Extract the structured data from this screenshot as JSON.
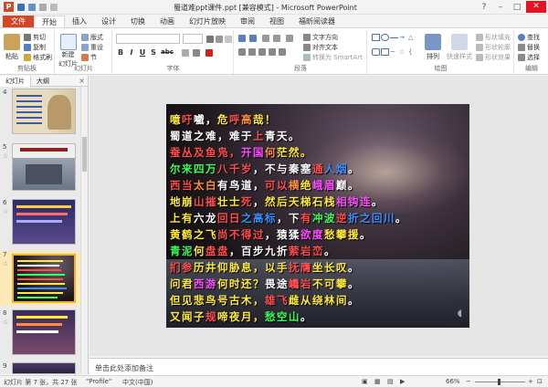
{
  "window": {
    "title": "蜀道难ppt课件.ppt [兼容模式] - Microsoft PowerPoint",
    "app_logo": "P"
  },
  "tabs": [
    "文件",
    "开始",
    "插入",
    "设计",
    "切换",
    "动画",
    "幻灯片放映",
    "审阅",
    "视图",
    "福昕阅读器"
  ],
  "ribbon": {
    "clipboard": {
      "paste": "粘贴",
      "cut": "剪切",
      "copy": "复制",
      "format_painter": "格式刷",
      "label": "剪贴板"
    },
    "slides": {
      "new_slide": "新建",
      "new_slide2": "幻灯片",
      "layout": "版式",
      "reset": "重设",
      "section": "节",
      "label": "幻灯片"
    },
    "font": {
      "label": "字体",
      "bold": "B",
      "italic": "I",
      "underline": "U",
      "shadow": "S",
      "strike": "abc"
    },
    "paragraph": {
      "text_direction": "文字方向",
      "align_text": "对齐文本",
      "smartart": "转换为 SmartArt",
      "label": "段落"
    },
    "drawing": {
      "arrange": "排列",
      "quick_styles": "快速样式",
      "shape_fill": "形状填充",
      "shape_outline": "形状轮廓",
      "shape_effects": "形状效果",
      "label": "绘图"
    },
    "editing": {
      "find": "查找",
      "replace": "替换",
      "select": "选择",
      "label": "编辑"
    }
  },
  "panel": {
    "tabs": [
      "幻灯片",
      "大纲"
    ],
    "close": "×",
    "thumbs": [
      {
        "num": "4",
        "selected": false
      },
      {
        "num": "5",
        "selected": false
      },
      {
        "num": "6",
        "selected": false
      },
      {
        "num": "7",
        "selected": true
      },
      {
        "num": "8",
        "selected": false
      },
      {
        "num": "9",
        "selected": false
      }
    ]
  },
  "slide": {
    "lines": [
      {
        "segments": [
          [
            "噫",
            "#ffea3a"
          ],
          [
            "吁",
            "#ff4d4d"
          ],
          [
            "嚱",
            "#ffffff"
          ],
          [
            "，",
            "#ffffff"
          ],
          [
            "危",
            "#ffea3a"
          ],
          [
            "呼",
            "#ff4d4d"
          ],
          [
            "高",
            "#ff8f3a"
          ],
          [
            "哉",
            "#ffea3a"
          ],
          [
            "！",
            "#ffea3a"
          ]
        ]
      },
      {
        "segments": [
          [
            "蜀道之难，",
            "#ffffff"
          ],
          [
            "难于",
            "#ffffff"
          ],
          [
            "上",
            "#ff4d4d"
          ],
          [
            "青天",
            "#ffffff"
          ],
          [
            "。",
            "#ffffff"
          ]
        ]
      },
      {
        "segments": [
          [
            "蚕丛及鱼凫，",
            "#ff4d4d"
          ],
          [
            "开国",
            "#ff4dff"
          ],
          [
            "何",
            "#ff8f3a"
          ],
          [
            "茫然。",
            "#ffea3a"
          ]
        ]
      },
      {
        "segments": [
          [
            "尔来四万",
            "#3aff5a"
          ],
          [
            "八千岁",
            "#ff4d4d"
          ],
          [
            "，",
            "#ffffff"
          ],
          [
            "不与秦塞",
            "#ffffff"
          ],
          [
            "通",
            "#ff4d4d"
          ],
          [
            "人烟",
            "#3a8fff"
          ],
          [
            "。",
            "#ffffff"
          ]
        ]
      },
      {
        "segments": [
          [
            "西当",
            "#ff4d4d"
          ],
          [
            "太白",
            "#ff8f3a"
          ],
          [
            "有鸟道，",
            "#ffffff"
          ],
          [
            "可以",
            "#ff4d4d"
          ],
          [
            "横",
            "#ff8f3a"
          ],
          [
            "绝",
            "#ffea3a"
          ],
          [
            "峨眉",
            "#ff4dff"
          ],
          [
            "巅",
            "#ffffff"
          ],
          [
            "。",
            "#ffffff"
          ]
        ]
      },
      {
        "segments": [
          [
            "地崩",
            "#ffea3a"
          ],
          [
            "山摧",
            "#ff4d4d"
          ],
          [
            "壮士",
            "#ffea3a"
          ],
          [
            "死",
            "#ff4d4d"
          ],
          [
            "，",
            "#ffffff"
          ],
          [
            "然后天梯石栈",
            "#ffea3a"
          ],
          [
            "相钩连",
            "#ff4dff"
          ],
          [
            "。",
            "#ffffff"
          ]
        ]
      },
      {
        "segments": [
          [
            "上有",
            "#ffea3a"
          ],
          [
            "六龙",
            "#ffffff"
          ],
          [
            "回日",
            "#ff4d4d"
          ],
          [
            "之高标",
            "#3a8fff"
          ],
          [
            "，下",
            "#ffffff"
          ],
          [
            "有",
            "#ff4d4d"
          ],
          [
            "冲波",
            "#3aff5a"
          ],
          [
            "逆",
            "#ff4d4d"
          ],
          [
            "折之回川",
            "#3a8fff"
          ],
          [
            "。",
            "#ffffff"
          ]
        ]
      },
      {
        "segments": [
          [
            "黄鹤之飞",
            "#ffea3a"
          ],
          [
            "尚不得过",
            "#ff4d4d"
          ],
          [
            "，",
            "#ffffff"
          ],
          [
            "猿猱",
            "#ffffff"
          ],
          [
            "欲度",
            "#ff4dff"
          ],
          [
            "愁攀援",
            "#ffea3a"
          ],
          [
            "。",
            "#ffffff"
          ]
        ]
      },
      {
        "segments": [
          [
            "青泥",
            "#3aff5a"
          ],
          [
            "何",
            "#ffea3a"
          ],
          [
            "盘盘",
            "#ff4d4d"
          ],
          [
            "，",
            "#ffffff"
          ],
          [
            "百步九折",
            "#ffffff"
          ],
          [
            "萦岩峦",
            "#ff4d4d"
          ],
          [
            "。",
            "#ffffff"
          ]
        ]
      },
      {
        "segments": [
          [
            "扪参",
            "#ff4d4d"
          ],
          [
            "历井仰胁息，",
            "#ffea3a"
          ],
          [
            "以手",
            "#ffea3a"
          ],
          [
            "抚膺",
            "#ff4d4d"
          ],
          [
            "坐长叹",
            "#ffea3a"
          ],
          [
            "。",
            "#ffffff"
          ]
        ]
      },
      {
        "segments": [
          [
            "问君",
            "#ffea3a"
          ],
          [
            "西游",
            "#ff4dff"
          ],
          [
            "何时还？",
            "#ffea3a"
          ],
          [
            "畏途",
            "#ffffff"
          ],
          [
            "巉岩",
            "#ff4d4d"
          ],
          [
            "不可攀",
            "#ffea3a"
          ],
          [
            "。",
            "#ffffff"
          ]
        ]
      },
      {
        "segments": [
          [
            "但见悲鸟号古木，",
            "#ffea3a"
          ],
          [
            "雄飞",
            "#ff4d4d"
          ],
          [
            "雌从",
            "#ffea3a"
          ],
          [
            "绕林间",
            "#ffea3a"
          ],
          [
            "。",
            "#ffffff"
          ]
        ]
      },
      {
        "segments": [
          [
            "又闻子",
            "#ffea3a"
          ],
          [
            "规",
            "#ff4d4d"
          ],
          [
            "啼夜月，",
            "#ffea3a"
          ],
          [
            "愁空山",
            "#3aff5a"
          ],
          [
            "。",
            "#ffffff"
          ]
        ]
      }
    ]
  },
  "notes": {
    "placeholder": "单击此处添加备注"
  },
  "status": {
    "slide_info": "幻灯片 第 7 张，共 27 张",
    "theme": "\"Profile\"",
    "lang": "中文(中国)",
    "zoom": "66%"
  }
}
